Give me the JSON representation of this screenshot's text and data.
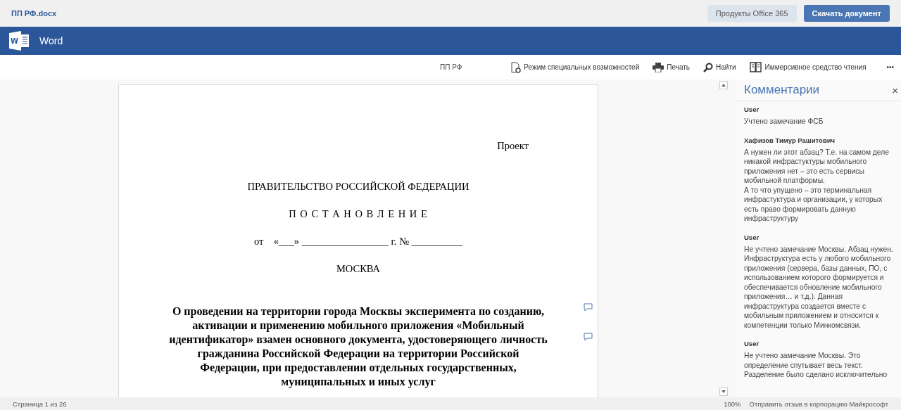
{
  "file_name": "ПП РФ.docx",
  "header_buttons": [
    {
      "label": "Продукты Office 365",
      "kind": "secondary"
    },
    {
      "label": "Скачать документ",
      "kind": "primary"
    }
  ],
  "app_bar": {
    "title": "Word",
    "logo_letter": "W"
  },
  "toolbar": {
    "doc_title": "ПП РФ",
    "actions": [
      {
        "label": "Режим специальных возможностей",
        "kind": "accessibility"
      },
      {
        "label": "Печать",
        "kind": "print"
      },
      {
        "label": "Найти",
        "kind": "find"
      },
      {
        "label": "Иммерсивное средство чтения",
        "kind": "reader"
      }
    ],
    "more": "•••"
  },
  "document": {
    "paragraphs": [
      {
        "kind": "right",
        "text": "Проект"
      },
      {
        "kind": "center",
        "text": "ПРАВИТЕЛЬСТВО РОССИЙСКОЙ ФЕДЕРАЦИИ"
      },
      {
        "kind": "spaced",
        "text": "П О С Т А Н О В Л Е Н И Е"
      },
      {
        "kind": "center",
        "text": "от    «___» _________________ г. № __________"
      },
      {
        "kind": "center",
        "text": "МОСКВА"
      },
      {
        "kind": "title",
        "text": "О проведении на территории города Москвы эксперимента по созданию, активации и применению мобильного приложения «Мобильный идентификатор» взамен основного документа, удостоверяющего личность гражданина Российской Федерации на территории Российской Федерации, при предоставлении отдельных государственных, муниципальных и иных услуг"
      }
    ]
  },
  "comments_pane": {
    "title": "Комментарии",
    "close": "×",
    "comments": [
      {
        "author": "User",
        "text": "Учтено замечание ФСБ"
      },
      {
        "author": "Хафизов Тимур Рашитович",
        "text": "А нужен ли этот абзац? Т.е. на самом деле никакой инфрастуктуры мобильного приложения нет – это есть сервисы мобильной платформы.\nА то что упущено – это терминальная инфрастуктура и организации, у которых есть право формировать данную инфраструктуру"
      },
      {
        "author": "User",
        "text": "Не учтено замечание Москвы. Абзац нужен. Инфраструктура есть у любого мобильного приложения (сервера, базы данных, ПО, с использованием которого формируется и обеспечивается обновление мобильного приложения… и т.д.). Данная инфраструктура создается вместе с мобильным приложением и относится к компетенции только Минкомсвязи."
      },
      {
        "author": "User",
        "text": "Не учтено замечание Москвы. Это определение спутывает весь текст. Разделение было сделано исключительно"
      }
    ]
  },
  "status_bar": {
    "page": "Страница 1 из 26",
    "zoom": "100%",
    "feedback": "Отправить отзыв в корпорацию Майкрософт"
  }
}
